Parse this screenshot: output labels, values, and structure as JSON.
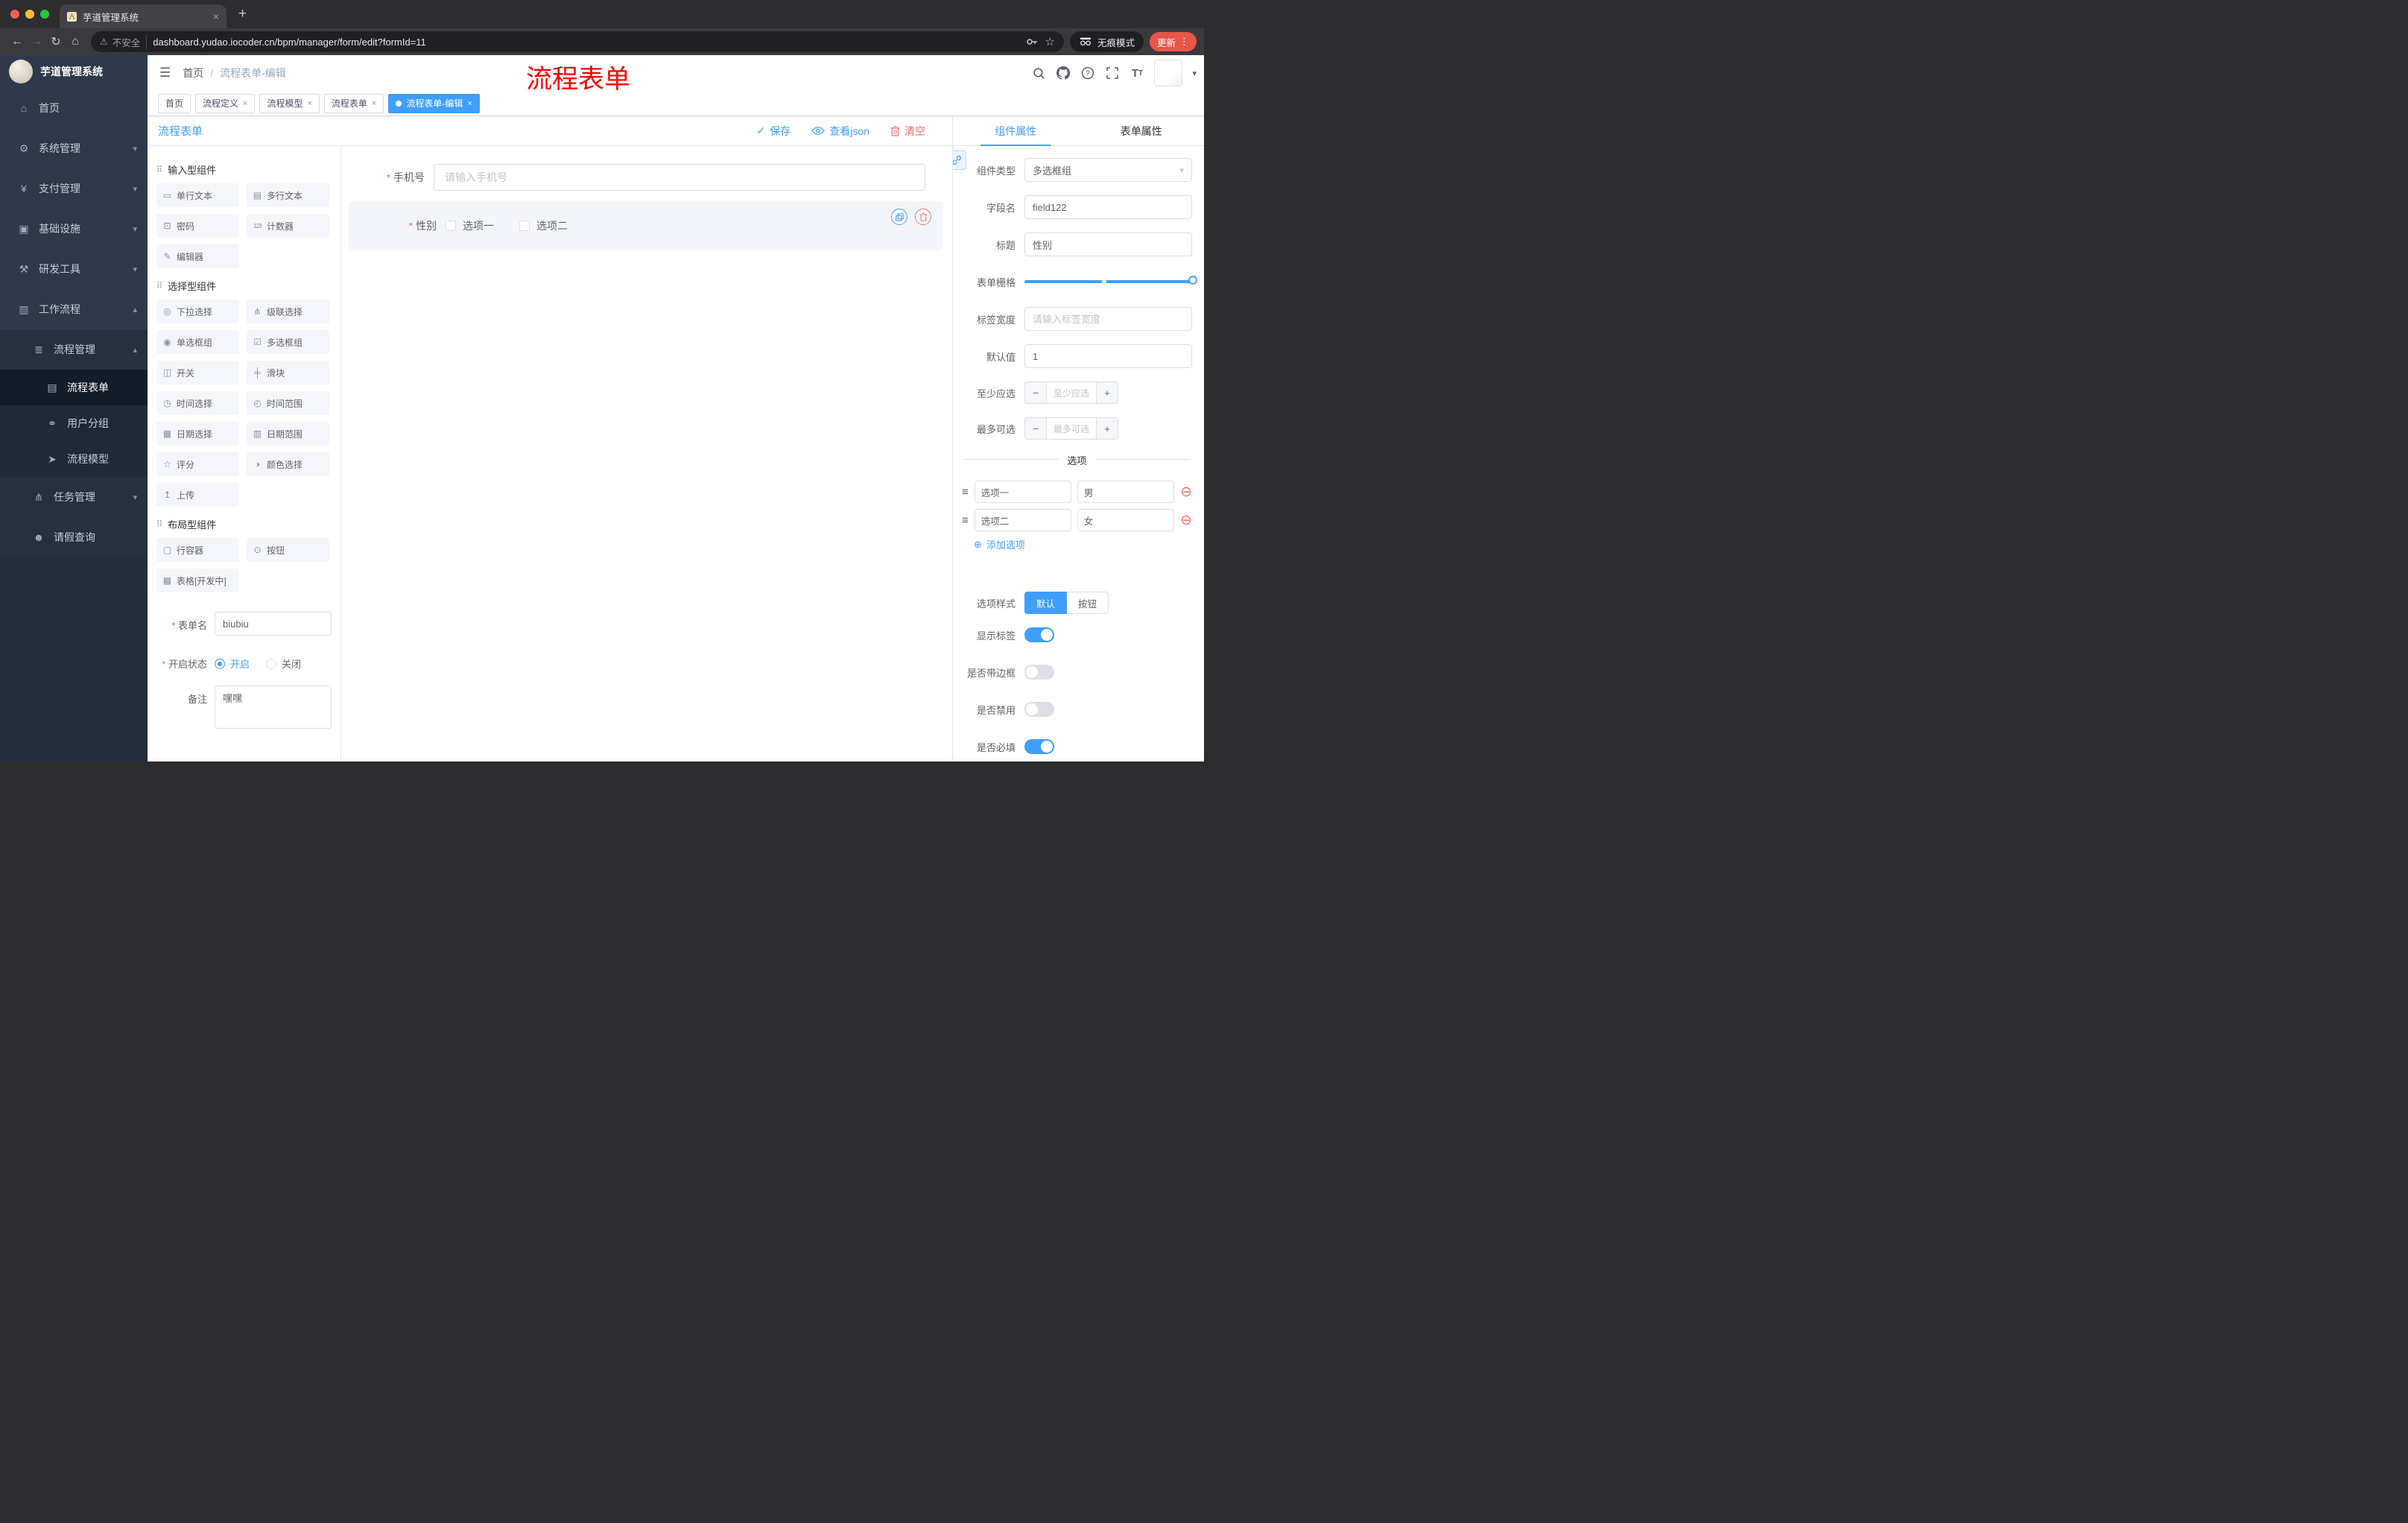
{
  "browser": {
    "tab_title": "芋道管理系统",
    "security_label": "不安全",
    "url": "dashboard.yudao.iocoder.cn/bpm/manager/form/edit?formId=11",
    "incognito_label": "无痕模式",
    "update_label": "更新"
  },
  "glyphs": {
    "close": "×",
    "plus": "+",
    "back": "←",
    "forward": "→",
    "reload": "↻",
    "home": "⌂",
    "warn": "⚠",
    "star": "☆",
    "kebab": "⋮",
    "hamburger": "☰",
    "slash": "/",
    "caret_down": "▾",
    "check": "✓",
    "minus": "−",
    "add_circle": "⊕",
    "remove_circle": "⊖",
    "drag": "≡",
    "section_drag": "⠿"
  },
  "sidebar": {
    "logo_title": "芋道管理系统",
    "items": [
      {
        "label": "首页",
        "glyph": "⌂"
      },
      {
        "label": "系统管理",
        "glyph": "⚙",
        "chevron": "▾"
      },
      {
        "label": "支付管理",
        "glyph": "¥",
        "chevron": "▾"
      },
      {
        "label": "基础设施",
        "glyph": "▣",
        "chevron": "▾"
      },
      {
        "label": "研发工具",
        "glyph": "⚒",
        "chevron": "▾"
      },
      {
        "label": "工作流程",
        "glyph": "▥",
        "chevron": "▴"
      },
      {
        "label": "流程管理",
        "glyph": "≣",
        "chevron": "▴"
      },
      {
        "label": "流程表单",
        "glyph": "▤"
      },
      {
        "label": "用户分组",
        "glyph": "⚭"
      },
      {
        "label": "流程模型",
        "glyph": "➤"
      },
      {
        "label": "任务管理",
        "glyph": "⋔",
        "chevron": "▾"
      },
      {
        "label": "请假查询",
        "glyph": "☻"
      }
    ]
  },
  "header": {
    "breadcrumb_home": "首页",
    "breadcrumb_current": "流程表单-编辑",
    "annotation": "流程表单"
  },
  "tags": {
    "items": [
      {
        "label": "首页"
      },
      {
        "label": "流程定义"
      },
      {
        "label": "流程模型"
      },
      {
        "label": "流程表单"
      },
      {
        "label": "流程表单-编辑"
      }
    ]
  },
  "designer": {
    "title": "流程表单",
    "actions": {
      "save": "保存",
      "view_json": "查看json",
      "clear": "清空"
    },
    "palette": {
      "sections": [
        {
          "title": "输入型组件",
          "items": [
            {
              "label": "单行文本",
              "glyph": "▭"
            },
            {
              "label": "多行文本",
              "glyph": "▤"
            },
            {
              "label": "密码",
              "glyph": "⊡"
            },
            {
              "label": "计数器",
              "glyph": "123"
            },
            {
              "label": "编辑器",
              "glyph": "✎"
            }
          ]
        },
        {
          "title": "选择型组件",
          "items": [
            {
              "label": "下拉选择",
              "glyph": "◎"
            },
            {
              "label": "级联选择",
              "glyph": "⋔"
            },
            {
              "label": "单选框组",
              "glyph": "◉"
            },
            {
              "label": "多选框组",
              "glyph": "☑"
            },
            {
              "label": "开关",
              "glyph": "◫"
            },
            {
              "label": "滑块",
              "glyph": "╪"
            },
            {
              "label": "时间选择",
              "glyph": "◷"
            },
            {
              "label": "时间范围",
              "glyph": "◴"
            },
            {
              "label": "日期选择",
              "glyph": "▦"
            },
            {
              "label": "日期范围",
              "glyph": "▥"
            },
            {
              "label": "评分",
              "glyph": "☆"
            },
            {
              "label": "颜色选择",
              "glyph": "◑"
            },
            {
              "label": "上传",
              "glyph": "↥"
            }
          ]
        },
        {
          "title": "布局型组件",
          "items": [
            {
              "label": "行容器",
              "glyph": "▢"
            },
            {
              "label": "按钮",
              "glyph": "⊙"
            },
            {
              "label": "表格[开发中]",
              "glyph": "▩"
            }
          ]
        }
      ]
    },
    "form": {
      "name_label": "表单名",
      "name_value": "biubiu",
      "status_label": "开启状态",
      "status_on": "开启",
      "status_off": "关闭",
      "remark_label": "备注",
      "remark_value": "嘿嘿"
    },
    "canvas": {
      "phone_label": "手机号",
      "phone_placeholder": "请输入手机号",
      "gender_label": "性别",
      "option1": "选项一",
      "option2": "选项二"
    }
  },
  "properties": {
    "tab_component": "组件属性",
    "tab_form": "表单属性",
    "fields": {
      "type_label": "组件类型",
      "type_value": "多选框组",
      "field_label": "字段名",
      "field_value": "field122",
      "title_label": "标题",
      "title_value": "性别",
      "grid_label": "表单栅格",
      "width_label": "标签宽度",
      "width_placeholder": "请输入标签宽度",
      "default_label": "默认值",
      "default_value": "1",
      "min_label": "至少应选",
      "min_placeholder": "至少应选",
      "max_label": "最多可选",
      "max_placeholder": "最多可选"
    },
    "options": {
      "divider": "选项",
      "rows": [
        {
          "label": "选项一",
          "value": "男"
        },
        {
          "label": "选项二",
          "value": "女"
        }
      ],
      "add_label": "添加选项"
    },
    "style": {
      "style_label": "选项样式",
      "default_btn": "默认",
      "button_btn": "按钮",
      "show_label": "显示标签",
      "border_label": "是否带边框",
      "disabled_label": "是否禁用",
      "required_label": "是否必填"
    },
    "switches": {
      "show": true,
      "border": false,
      "disabled": false,
      "required": true
    }
  },
  "colors": {
    "primary": "#409eff",
    "danger": "#f56c6c",
    "annotation": "#fe0000"
  }
}
